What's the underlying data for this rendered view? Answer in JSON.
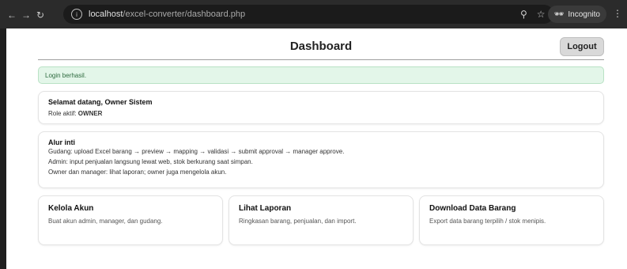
{
  "browser": {
    "url_host": "localhost",
    "url_path": "/excel-converter/dashboard.php",
    "incognito_label": "Incognito"
  },
  "page": {
    "title": "Dashboard",
    "logout_label": "Logout",
    "alert": "Login berhasil.",
    "welcome": {
      "heading": "Selamat datang, Owner Sistem",
      "role_prefix": "Role aktif: ",
      "role": "OWNER"
    },
    "flow": {
      "heading": "Alur inti",
      "lines": [
        "Gudang: upload Excel barang → preview → mapping → validasi → submit approval → manager approve.",
        "Admin: input penjualan langsung lewat web, stok berkurang saat simpan.",
        "Owner dan manager: lihat laporan; owner juga mengelola akun."
      ]
    },
    "features": [
      {
        "title": "Kelola Akun",
        "desc": "Buat akun admin, manager, dan gudang."
      },
      {
        "title": "Lihat Laporan",
        "desc": "Ringkasan barang, penjualan, dan import."
      },
      {
        "title": "Download Data Barang",
        "desc": "Export data barang terpilih / stok menipis."
      }
    ]
  },
  "colors": {
    "alert_bg": "#e3f6e9",
    "logout_bg": "#d9d9d9"
  }
}
